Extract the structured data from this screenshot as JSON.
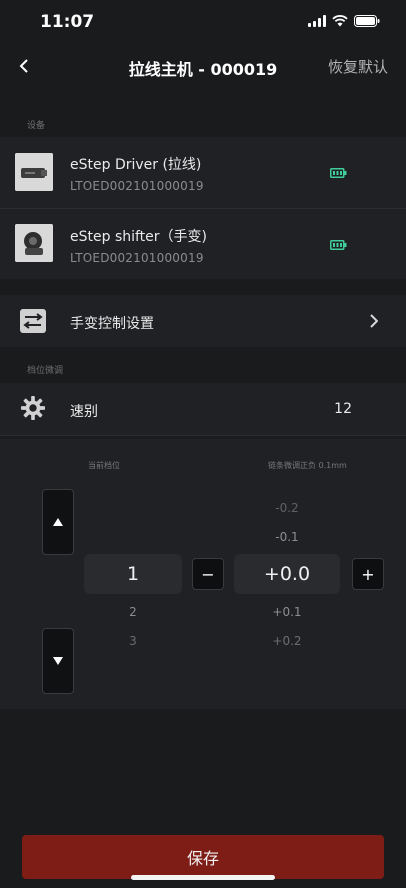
{
  "status_bar": {
    "time": "11:07"
  },
  "nav": {
    "title": "拉线主机 - 000019",
    "reset_label": "恢复默认"
  },
  "devices_section": {
    "label": "设备",
    "devices": [
      {
        "name": "eStep Driver (拉线)",
        "serial": "LTOED002101000019",
        "icon": "battery-icon"
      },
      {
        "name": "eStep shifter（手变)",
        "serial": "LTOED002101000019",
        "icon": "battery-icon"
      }
    ]
  },
  "shift_settings": {
    "label": "手变控制设置",
    "icon": "sliders-icon"
  },
  "tuning_section": {
    "label": "档位微调",
    "speed_label": "速别",
    "speed_value": "12",
    "current_gear_header": "当前档位",
    "chain_tune_header": "链条微调正负 0.1mm",
    "gear_current": "1",
    "gear_next": [
      "2",
      "3"
    ],
    "tune_above": [
      "-0.2",
      "-0.1"
    ],
    "tune_current": "+0.0",
    "tune_below": [
      "+0.1",
      "+0.2"
    ],
    "minus_label": "−",
    "plus_label": "+"
  },
  "save_label": "保存",
  "colors": {
    "accent_save": "#7d1d16",
    "battery": "#3ecf9a",
    "background": "#1a1b1d",
    "panel": "#202124"
  }
}
